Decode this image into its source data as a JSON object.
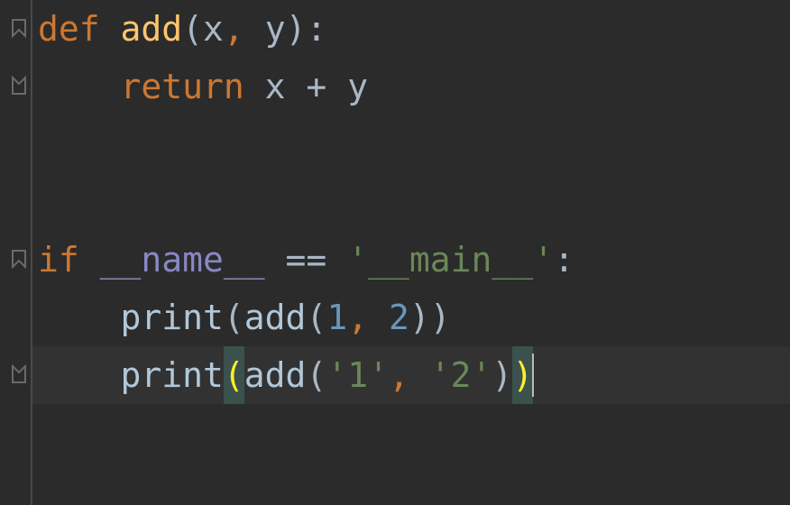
{
  "code": {
    "lines": [
      {
        "indent": 0,
        "tokens": [
          {
            "t": "def ",
            "cls": "tok-kw"
          },
          {
            "t": "add",
            "cls": "tok-fn"
          },
          {
            "t": "(x",
            "cls": "tok-punc"
          },
          {
            "t": ",",
            "cls": "tok-comma"
          },
          {
            "t": " y):",
            "cls": "tok-punc"
          }
        ],
        "fold": "open-top"
      },
      {
        "indent": 1,
        "tokens": [
          {
            "t": "return ",
            "cls": "tok-kw"
          },
          {
            "t": "x ",
            "cls": "tok-id"
          },
          {
            "t": "+",
            "cls": "tok-op"
          },
          {
            "t": " y",
            "cls": "tok-id"
          }
        ],
        "fold": "close"
      },
      {
        "indent": 0,
        "tokens": [],
        "fold": null
      },
      {
        "indent": 0,
        "tokens": [],
        "fold": null
      },
      {
        "indent": 0,
        "tokens": [
          {
            "t": "if ",
            "cls": "tok-kw"
          },
          {
            "t": "__name__ ",
            "cls": "tok-builtin"
          },
          {
            "t": "== ",
            "cls": "tok-op"
          },
          {
            "t": "'__main__'",
            "cls": "tok-str"
          },
          {
            "t": ":",
            "cls": "tok-punc"
          }
        ],
        "fold": "open-top"
      },
      {
        "indent": 1,
        "tokens": [
          {
            "t": "print",
            "cls": "tok-call"
          },
          {
            "t": "(",
            "cls": "tok-punc"
          },
          {
            "t": "add",
            "cls": "tok-call"
          },
          {
            "t": "(",
            "cls": "tok-punc"
          },
          {
            "t": "1",
            "cls": "tok-num"
          },
          {
            "t": ",",
            "cls": "tok-comma"
          },
          {
            "t": " ",
            "cls": "tok-punc"
          },
          {
            "t": "2",
            "cls": "tok-num"
          },
          {
            "t": "))",
            "cls": "tok-punc"
          }
        ],
        "fold": null
      },
      {
        "indent": 1,
        "current": true,
        "caret_end": true,
        "tokens": [
          {
            "t": "print",
            "cls": "tok-call"
          },
          {
            "t": "(",
            "cls": "tok-punc bracket-match yellow"
          },
          {
            "t": "add",
            "cls": "tok-call"
          },
          {
            "t": "(",
            "cls": "tok-punc"
          },
          {
            "t": "'1'",
            "cls": "tok-str"
          },
          {
            "t": ",",
            "cls": "tok-comma"
          },
          {
            "t": " ",
            "cls": "tok-punc"
          },
          {
            "t": "'2'",
            "cls": "tok-str"
          },
          {
            "t": ")",
            "cls": "tok-punc"
          },
          {
            "t": ")",
            "cls": "tok-punc bracket-match yellow"
          }
        ],
        "fold": "close"
      }
    ]
  }
}
